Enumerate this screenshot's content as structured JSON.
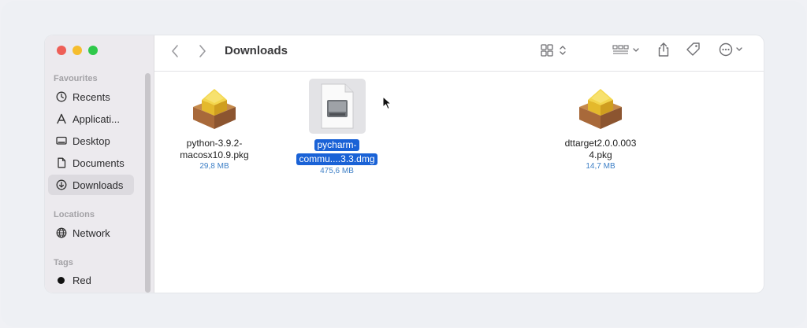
{
  "window": {
    "traffic_lights": {
      "close": "#ee5f57",
      "minimize": "#f5bd2e",
      "zoom": "#2fc84a"
    },
    "title": "Downloads"
  },
  "toolbar": {
    "back_icon": "chevron-left-icon",
    "forward_icon": "chevron-right-icon",
    "view_icon": "grid-view-icon",
    "group_icon": "group-icon",
    "share_icon": "share-icon",
    "tag_icon": "tag-icon",
    "more_icon": "ellipsis-circle-icon",
    "search_icon": "search-icon"
  },
  "sidebar": {
    "favourites_label": "Favourites",
    "favourites": [
      {
        "label": "Recents",
        "icon": "clock-icon"
      },
      {
        "label": "Applicati...",
        "icon": "applications-icon"
      },
      {
        "label": "Desktop",
        "icon": "desktop-icon"
      },
      {
        "label": "Documents",
        "icon": "document-icon"
      },
      {
        "label": "Downloads",
        "icon": "download-icon",
        "active": true
      }
    ],
    "locations_label": "Locations",
    "locations": [
      {
        "label": "Network",
        "icon": "globe-icon"
      }
    ],
    "tags_label": "Tags",
    "tags": [
      {
        "label": "Red",
        "color": "#111111"
      }
    ]
  },
  "files": [
    {
      "name_line1": "python-3.9.2-",
      "name_line2": "macosx10.9.pkg",
      "size": "29,8 MB",
      "icon": "package-icon"
    },
    {
      "name_line1": "pycharm-",
      "name_line2": "commu....3.3.dmg",
      "size": "475,6 MB",
      "icon": "disk-image-icon",
      "selected": true
    },
    {
      "name_line1": "dttarget2.0.0.003",
      "name_line2": "4.pkg",
      "size": "14,7 MB",
      "icon": "package-icon"
    }
  ],
  "colors": {
    "selection": "#1a62d6",
    "size_text": "#3d7fc6"
  }
}
